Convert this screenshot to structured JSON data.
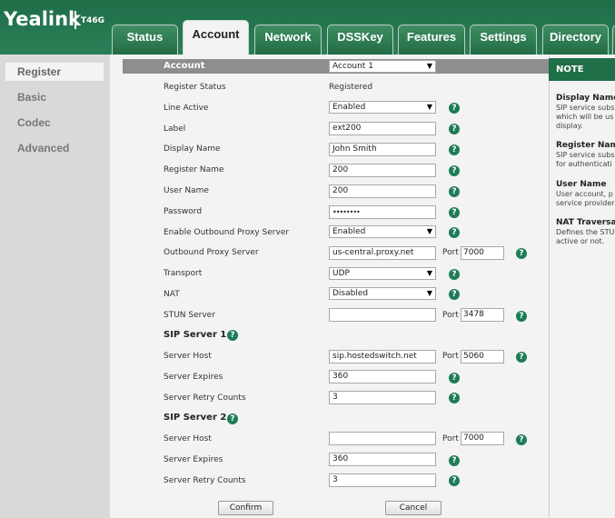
{
  "brand": {
    "name": "Yealink",
    "model": "T46G"
  },
  "tabs": [
    "Status",
    "Account",
    "Network",
    "DSSKey",
    "Features",
    "Settings",
    "Directory"
  ],
  "active_tab": "Account",
  "sidebar": [
    "Register",
    "Basic",
    "Codec",
    "Advanced"
  ],
  "header": {
    "label": "Account",
    "selected": "Account 1"
  },
  "fields": {
    "register_status": {
      "label": "Register Status",
      "value": "Registered"
    },
    "line_active": {
      "label": "Line Active",
      "value": "Enabled"
    },
    "label": {
      "label": "Label",
      "value": "ext200"
    },
    "display_name": {
      "label": "Display Name",
      "value": "John Smith"
    },
    "register_name": {
      "label": "Register Name",
      "value": "200"
    },
    "user_name": {
      "label": "User Name",
      "value": "200"
    },
    "password": {
      "label": "Password",
      "value": "••••••••"
    },
    "outbound_enable": {
      "label": "Enable Outbound Proxy Server",
      "value": "Enabled"
    },
    "outbound_server": {
      "label": "Outbound Proxy Server",
      "value": "us-central.proxy.net",
      "port": "7000"
    },
    "transport": {
      "label": "Transport",
      "value": "UDP"
    },
    "nat": {
      "label": "NAT",
      "value": "Disabled"
    },
    "stun_server": {
      "label": "STUN Server",
      "value": "",
      "port": "3478"
    }
  },
  "port_label": "Port",
  "sip1": {
    "title": "SIP Server 1",
    "host_label": "Server Host",
    "host": "sip.hostedswitch.net",
    "port": "5060",
    "expires_label": "Server Expires",
    "expires": "360",
    "retry_label": "Server Retry Counts",
    "retry": "3"
  },
  "sip2": {
    "title": "SIP Server 2",
    "host_label": "Server Host",
    "host": "",
    "port": "7000",
    "expires_label": "Server Expires",
    "expires": "360",
    "retry_label": "Server Retry Counts",
    "retry": "3"
  },
  "buttons": {
    "confirm": "Confirm",
    "cancel": "Cancel"
  },
  "help_glyph": "?",
  "select_arrow": "▼",
  "note": {
    "title": "NOTE",
    "items": [
      {
        "h": "Display Name",
        "lines": [
          "SIP service subs",
          "which will be us",
          "display."
        ]
      },
      {
        "h": "Register Name",
        "lines": [
          "SIP service subs",
          "for authenticati"
        ]
      },
      {
        "h": "User Name",
        "lines": [
          "User account, p",
          "service provider"
        ]
      },
      {
        "h": "NAT Traversal",
        "lines": [
          "Defines the STU",
          "active or not."
        ]
      }
    ]
  },
  "colors": {
    "brand_green": "#1e6e48",
    "help_green": "#1e7c57",
    "header_grey": "#8e8e8e",
    "sidebar_grey": "#d9d9d9"
  }
}
